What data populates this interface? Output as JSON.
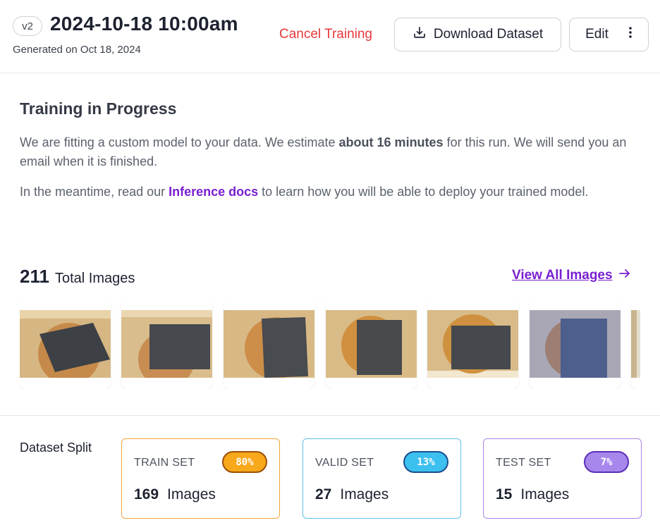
{
  "header": {
    "version": "v2",
    "title": "2024-10-18 10:00am",
    "generated": "Generated on Oct 18, 2024",
    "cancel_label": "Cancel Training",
    "download_label": "Download Dataset",
    "edit_label": "Edit"
  },
  "training": {
    "title": "Training in Progress",
    "para1_pre": "We are fitting a custom model to your data. We estimate ",
    "para1_bold": "about 16 minutes",
    "para1_post": " for this run. We will send you an email when it is finished.",
    "para2_pre": "In the meantime, read our ",
    "para2_link": "Inference docs",
    "para2_post": " to learn how you will be able to deploy your trained model."
  },
  "images": {
    "count": "211",
    "label": "Total Images",
    "view_all": "View All Images"
  },
  "split": {
    "label": "Dataset Split",
    "train": {
      "title": "TRAIN SET",
      "pct": "80%",
      "count": "169",
      "unit": "Images"
    },
    "valid": {
      "title": "VALID SET",
      "pct": "13%",
      "count": "27",
      "unit": "Images"
    },
    "test": {
      "title": "TEST SET",
      "pct": "7%",
      "count": "15",
      "unit": "Images"
    }
  },
  "colors": {
    "accent": "#7a1fd1",
    "danger": "#e5383b",
    "train": "#f7a81b",
    "valid": "#3cc0ef",
    "test": "#a887ec"
  },
  "icons": [
    "download-icon",
    "more-vertical-icon",
    "arrow-right-icon"
  ]
}
